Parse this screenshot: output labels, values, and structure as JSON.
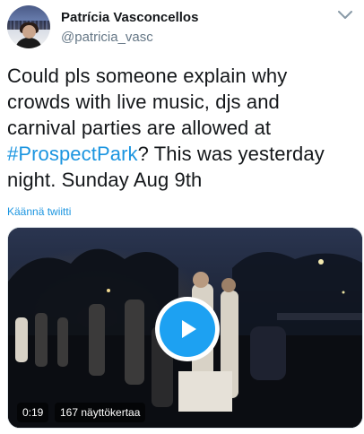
{
  "tweet": {
    "author": {
      "display_name": "Patrícia Vasconcellos",
      "handle": "@patricia_vasc"
    },
    "text_lines": [
      "Could pls someone explain why",
      "crowds with live music, djs and",
      "carnival parties are allowed at"
    ],
    "hashtag": "#ProspectPark",
    "text_after_hashtag": "? This was yesterday",
    "text_last_line": "night. Sunday Aug 9th",
    "translate_label": "Käännä twiitti",
    "video": {
      "duration": "0:19",
      "views": "167 näyttökertaa"
    }
  },
  "icons": {
    "menu": "chevron-down-icon",
    "play": "play-icon"
  },
  "colors": {
    "link": "#1b95e0",
    "play_button": "#1da1f2",
    "text": "#14171a",
    "secondary_text": "#657786"
  }
}
